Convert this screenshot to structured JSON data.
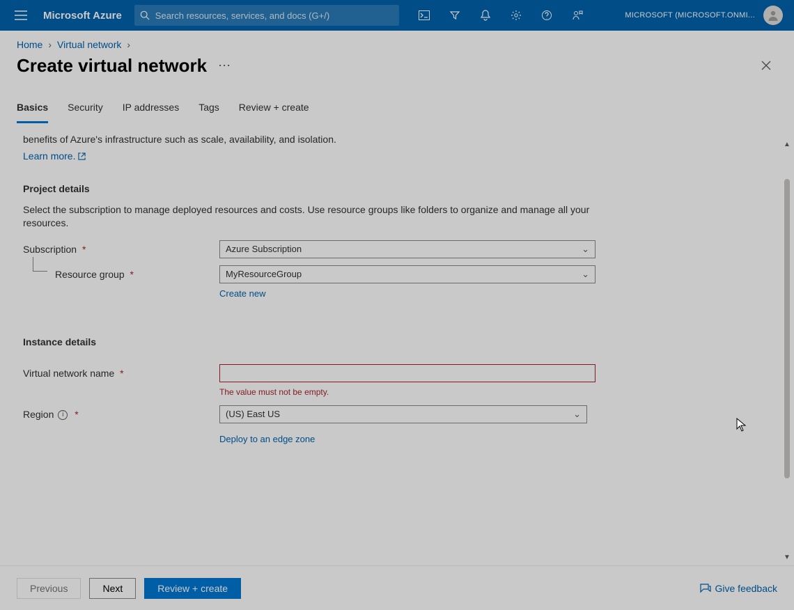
{
  "brand": "Microsoft Azure",
  "search": {
    "placeholder": "Search resources, services, and docs (G+/)"
  },
  "account": "MICROSOFT (MICROSOFT.ONMI...",
  "breadcrumbs": [
    "Home",
    "Virtual network"
  ],
  "page_title": "Create virtual network",
  "tabs": [
    "Basics",
    "Security",
    "IP addresses",
    "Tags",
    "Review + create"
  ],
  "active_tab": 0,
  "intro_trail": "benefits of Azure's infrastructure such as scale, availability, and isolation.",
  "learn_more": "Learn more.",
  "sections": {
    "project": {
      "heading": "Project details",
      "description": "Select the subscription to manage deployed resources and costs. Use resource groups like folders to organize and manage all your resources.",
      "subscription_label": "Subscription",
      "subscription_value": "Azure Subscription",
      "resource_group_label": "Resource group",
      "resource_group_value": "MyResourceGroup",
      "create_new": "Create new"
    },
    "instance": {
      "heading": "Instance details",
      "vnet_label": "Virtual network name",
      "vnet_value": "",
      "vnet_error": "The value must not be empty.",
      "region_label": "Region",
      "region_value": "(US) East US",
      "deploy_edge": "Deploy to an edge zone"
    }
  },
  "footer": {
    "previous": "Previous",
    "next": "Next",
    "review": "Review + create",
    "feedback": "Give feedback"
  },
  "required_marker": "*"
}
